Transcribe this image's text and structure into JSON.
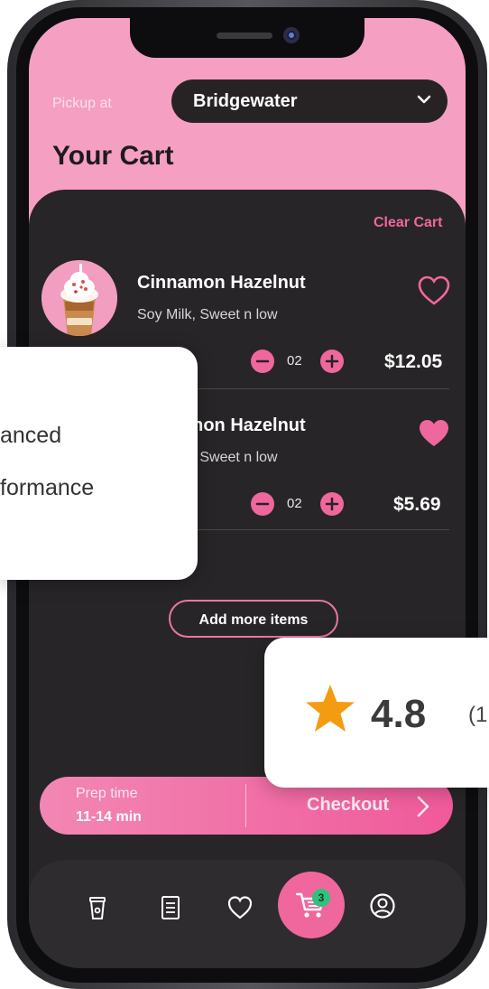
{
  "header": {
    "pickup_label": "Pickup at",
    "location": "Bridgewater",
    "title": "Your Cart"
  },
  "cart": {
    "clear_label": "Clear Cart",
    "items": [
      {
        "name": "Cinnamon Hazelnut",
        "options": "Soy Milk, Sweet n low",
        "quantity": "02",
        "price": "$12.05",
        "favorited": false
      },
      {
        "name": "Cinnamon Hazelnut",
        "options": "Soy Milk, Sweet n low",
        "quantity": "02",
        "price": "$5.69",
        "favorited": true
      }
    ],
    "add_more_label": "Add more items"
  },
  "checkout_bar": {
    "prep_label": "Prep time",
    "prep_value": "11-14 min",
    "checkout_label": "Checkout"
  },
  "bottom_nav": {
    "items": [
      "cup-icon",
      "menu-icon",
      "favorites-icon",
      "cart-icon",
      "profile-icon"
    ],
    "cart_badge": "3"
  },
  "overlays": {
    "feature_card": {
      "line1": "anced",
      "line2": "formance"
    },
    "rating_card": {
      "rating": "4.8",
      "count": "(1"
    }
  },
  "colors": {
    "accent": "#f0679d",
    "header_pink": "#f59fc3",
    "panel": "#272527",
    "badge": "#2ec27e",
    "star": "#f39c12"
  }
}
